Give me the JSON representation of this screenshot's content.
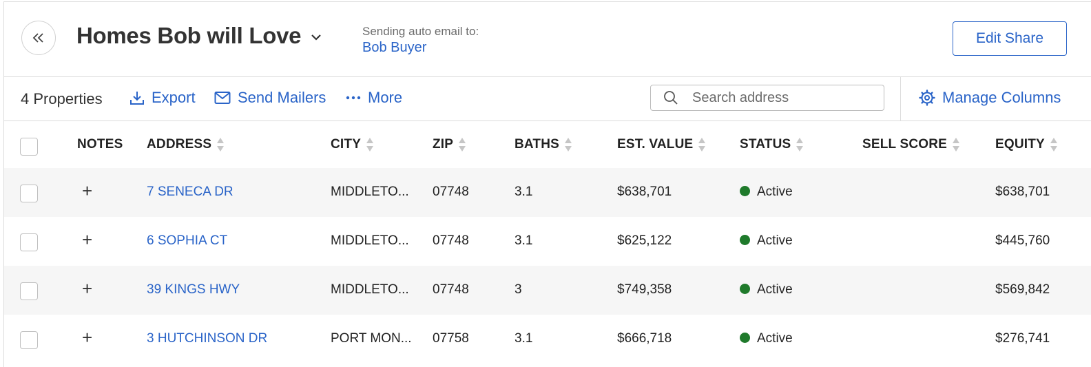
{
  "header": {
    "title": "Homes Bob will Love",
    "auto_email_label": "Sending auto email to:",
    "auto_email_recipient": "Bob Buyer",
    "edit_share_label": "Edit Share"
  },
  "toolbar": {
    "count": "4 Properties",
    "export_label": "Export",
    "send_mailers_label": "Send Mailers",
    "more_label": "More",
    "search_placeholder": "Search address",
    "manage_columns_label": "Manage Columns"
  },
  "table": {
    "columns": [
      "NOTES",
      "ADDRESS",
      "CITY",
      "ZIP",
      "BATHS",
      "EST. VALUE",
      "STATUS",
      "SELL SCORE",
      "EQUITY"
    ],
    "rows": [
      {
        "address": "7 SENECA DR",
        "city": "MIDDLETO...",
        "zip": "07748",
        "baths": "3.1",
        "est_value": "$638,701",
        "status": "Active",
        "sell_score": "",
        "equity": "$638,701"
      },
      {
        "address": "6 SOPHIA CT",
        "city": "MIDDLETO...",
        "zip": "07748",
        "baths": "3.1",
        "est_value": "$625,122",
        "status": "Active",
        "sell_score": "",
        "equity": "$445,760"
      },
      {
        "address": "39 KINGS HWY",
        "city": "MIDDLETO...",
        "zip": "07748",
        "baths": "3",
        "est_value": "$749,358",
        "status": "Active",
        "sell_score": "",
        "equity": "$569,842"
      },
      {
        "address": "3 HUTCHINSON DR",
        "city": "PORT MON...",
        "zip": "07758",
        "baths": "3.1",
        "est_value": "$666,718",
        "status": "Active",
        "sell_score": "",
        "equity": "$276,741"
      }
    ]
  },
  "colors": {
    "accent": "#2a64c8",
    "status_active": "#1f7a2b",
    "row_alt": "#f6f6f6"
  }
}
